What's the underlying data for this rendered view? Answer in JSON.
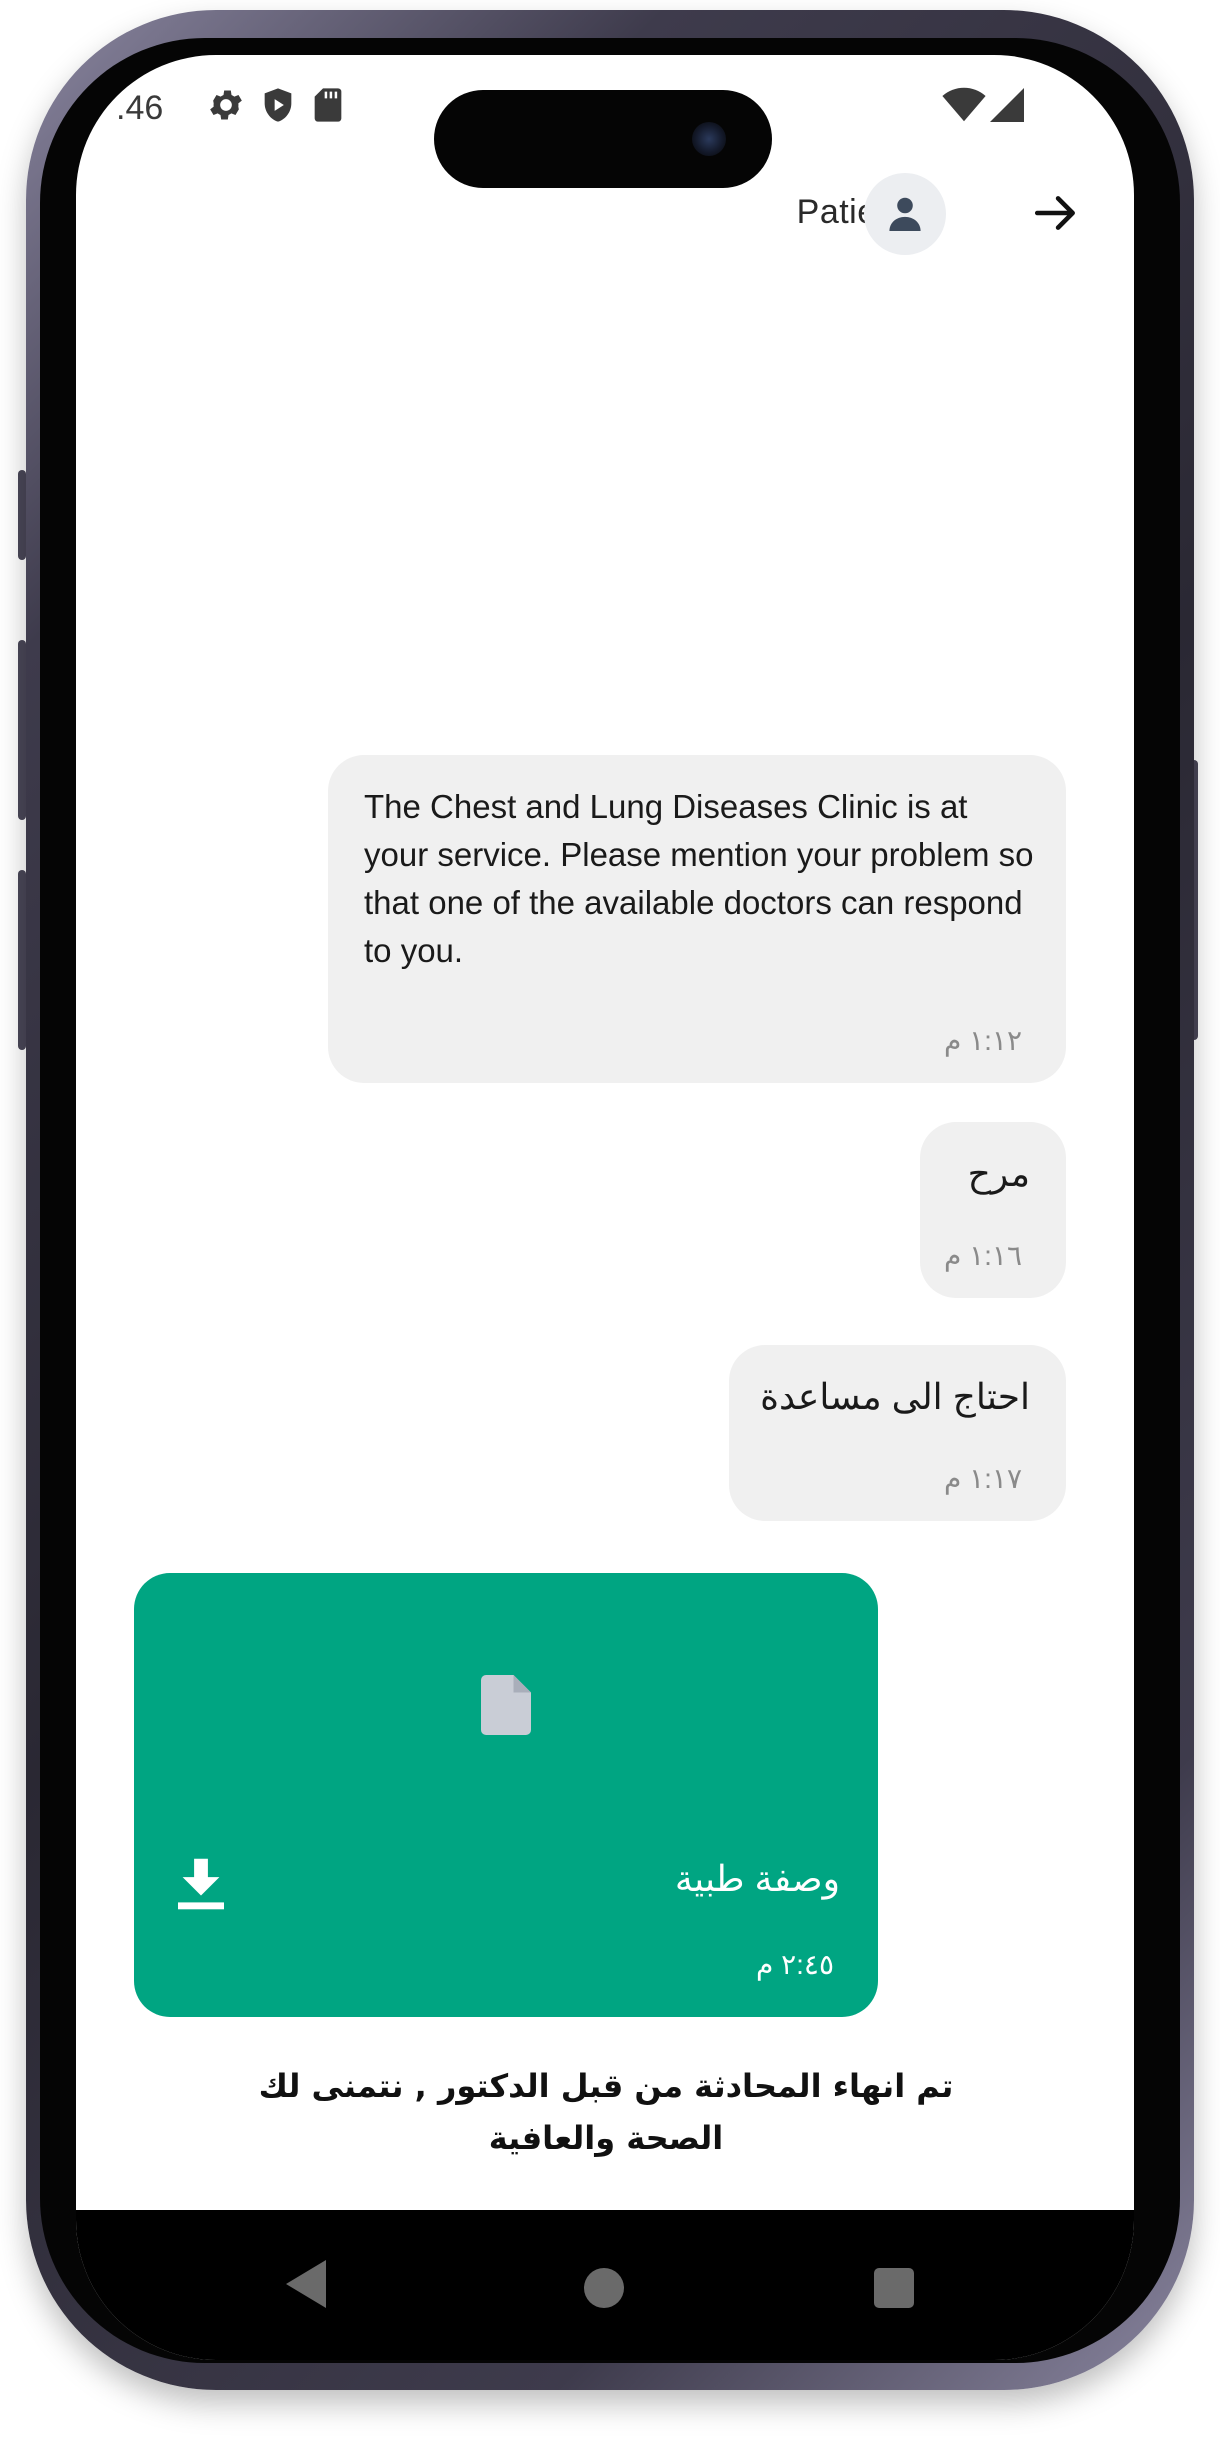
{
  "status_bar": {
    "time": ".46"
  },
  "header": {
    "title": "Patient"
  },
  "messages": [
    {
      "text": "The Chest and Lung Diseases Clinic is at your service. Please mention your problem so that one of the available doctors can respond to you.",
      "time": "١:١٢ م"
    },
    {
      "text": "مرح",
      "time": "١:١٦ م"
    },
    {
      "text": "احتاج الى مساعدة",
      "time": "١:١٧ م"
    }
  ],
  "file_message": {
    "name": "وصفة طبية",
    "time": "٢:٤٥ م"
  },
  "chat_end_notice": "تم انهاء المحادثة من قبل الدكتور , نتمنى لك الصحة والعافية",
  "colors": {
    "accent": "#00a582",
    "bubble": "#f0f0f0",
    "file_icon": "#c9cdd6"
  }
}
